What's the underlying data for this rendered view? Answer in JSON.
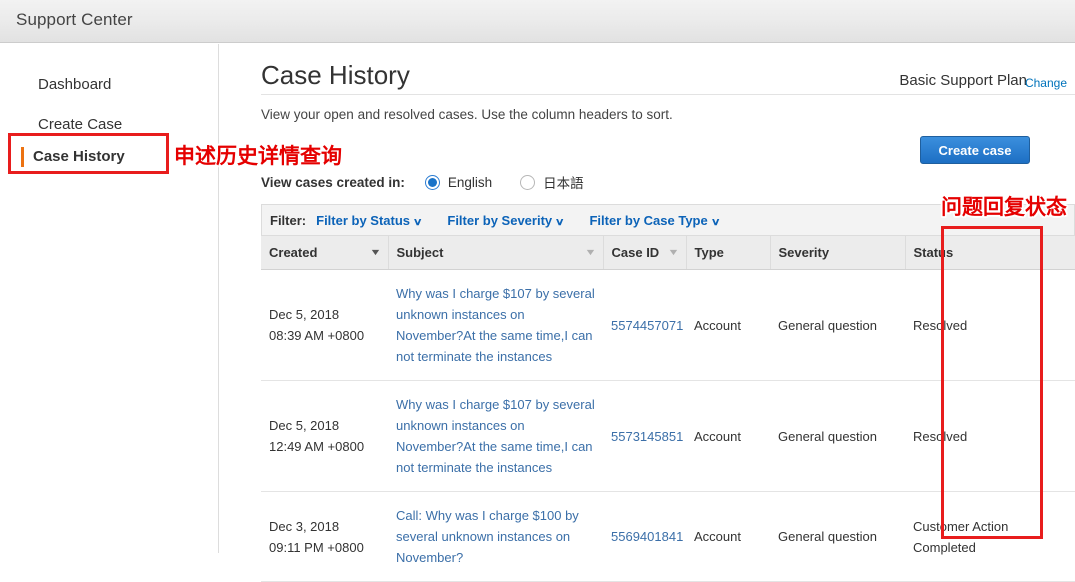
{
  "topbar": {
    "title": "Support Center"
  },
  "sidebar": {
    "items": [
      {
        "label": "Dashboard",
        "selected": false
      },
      {
        "label": "Create Case",
        "selected": false
      },
      {
        "label": "Case History",
        "selected": true
      }
    ]
  },
  "header": {
    "page_title": "Case History",
    "subtitle": "View your open and resolved cases. Use the column headers to sort.",
    "support_plan": "Basic Support Plan",
    "change_link": "Change",
    "create_case_button": "Create case"
  },
  "language": {
    "label": "View cases created in:",
    "options": [
      {
        "value": "English",
        "selected": true
      },
      {
        "value": "日本語",
        "selected": false
      }
    ]
  },
  "filters": {
    "label": "Filter:",
    "items": [
      {
        "label": "Filter by Status",
        "caret": "∨"
      },
      {
        "label": "Filter by Severity",
        "caret": "∨"
      },
      {
        "label": "Filter by Case Type",
        "caret": "∨"
      }
    ]
  },
  "table": {
    "columns": [
      {
        "key": "created",
        "label": "Created",
        "sortable": true,
        "caret": "▼"
      },
      {
        "key": "subject",
        "label": "Subject",
        "sortable": true,
        "caret": "▼"
      },
      {
        "key": "caseid",
        "label": "Case ID",
        "sortable": true,
        "caret": "▼"
      },
      {
        "key": "type",
        "label": "Type",
        "sortable": false,
        "caret": ""
      },
      {
        "key": "severity",
        "label": "Severity",
        "sortable": false,
        "caret": ""
      },
      {
        "key": "status",
        "label": "Status",
        "sortable": false,
        "caret": ""
      }
    ],
    "rows": [
      {
        "created": "Dec 5, 2018\n08:39 AM +0800",
        "subject": "Why was I charge $107 by several unknown instances on November?At the same time,I can not terminate the instances",
        "caseid": "5574457071",
        "type": "Account",
        "severity": "General question",
        "status": "Resolved"
      },
      {
        "created": "Dec 5, 2018\n12:49 AM +0800",
        "subject": "Why was I charge $107 by several unknown instances on November?At the same time,I can not terminate the instances",
        "caseid": "5573145851",
        "type": "Account",
        "severity": "General question",
        "status": "Resolved"
      },
      {
        "created": "Dec 3, 2018\n09:11 PM +0800",
        "subject": "Call: Why was I charge $100 by several unknown instances on November?",
        "caseid": "5569401841",
        "type": "Account",
        "severity": "General question",
        "status": "Customer Action Completed"
      }
    ]
  },
  "annotations": {
    "nav_note": "申述历史详情查询",
    "status_note": "问题回复状态"
  },
  "colors": {
    "accent_orange": "#ec7211",
    "link_blue": "#0073bb",
    "button_blue": "#1d6fc4",
    "annotation_red": "#e50000"
  }
}
